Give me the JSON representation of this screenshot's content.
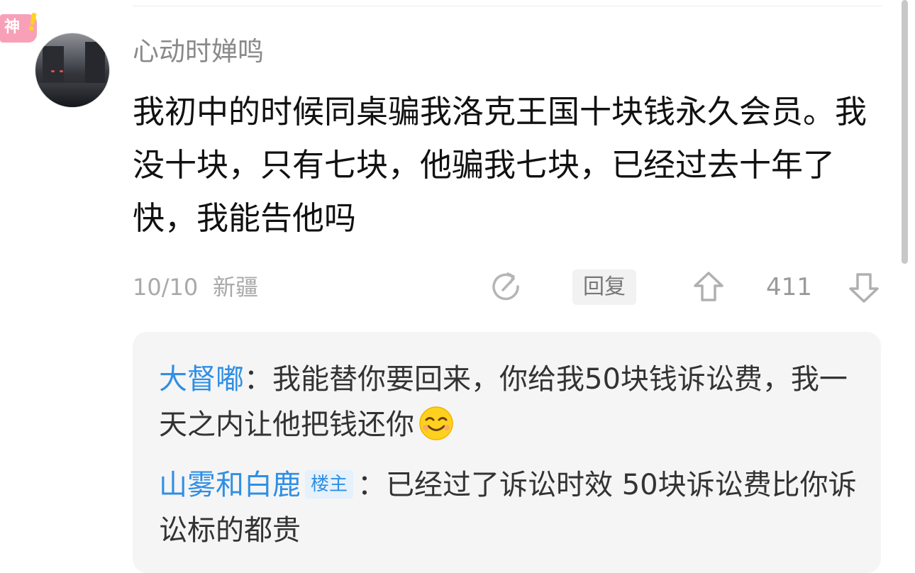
{
  "badge": {
    "text": "神",
    "mark": "!"
  },
  "comment": {
    "username": "心动时婵鸣",
    "content": "我初中的时候同桌骗我洛克王国十块钱永久会员。我没十块，只有七块，他骗我七块，已经过去十年了快，我能告他吗",
    "date": "10/10",
    "location": "新疆",
    "reply_label": "回复",
    "vote_count": "411",
    "icons": {
      "share": "share-icon",
      "upvote": "up-arrow-icon",
      "downvote": "down-arrow-icon"
    }
  },
  "replies": [
    {
      "author": "大督嘟",
      "separator": "：",
      "text": "我能替你要回来，你给我50块钱诉讼费，我一天之内让他把钱还你",
      "emoji": "grinning-face-emoji"
    },
    {
      "author": "山雾和白鹿",
      "badge": "楼主",
      "separator": "：",
      "text": "已经过了诉讼时效 50块诉讼费比你诉讼标的都贵"
    }
  ],
  "colors": {
    "link_blue": "#2f8fe5",
    "badge_pink": "#f8a0b8",
    "badge_yellow": "#ffd21c",
    "reply_bg": "#f5f5f5"
  }
}
